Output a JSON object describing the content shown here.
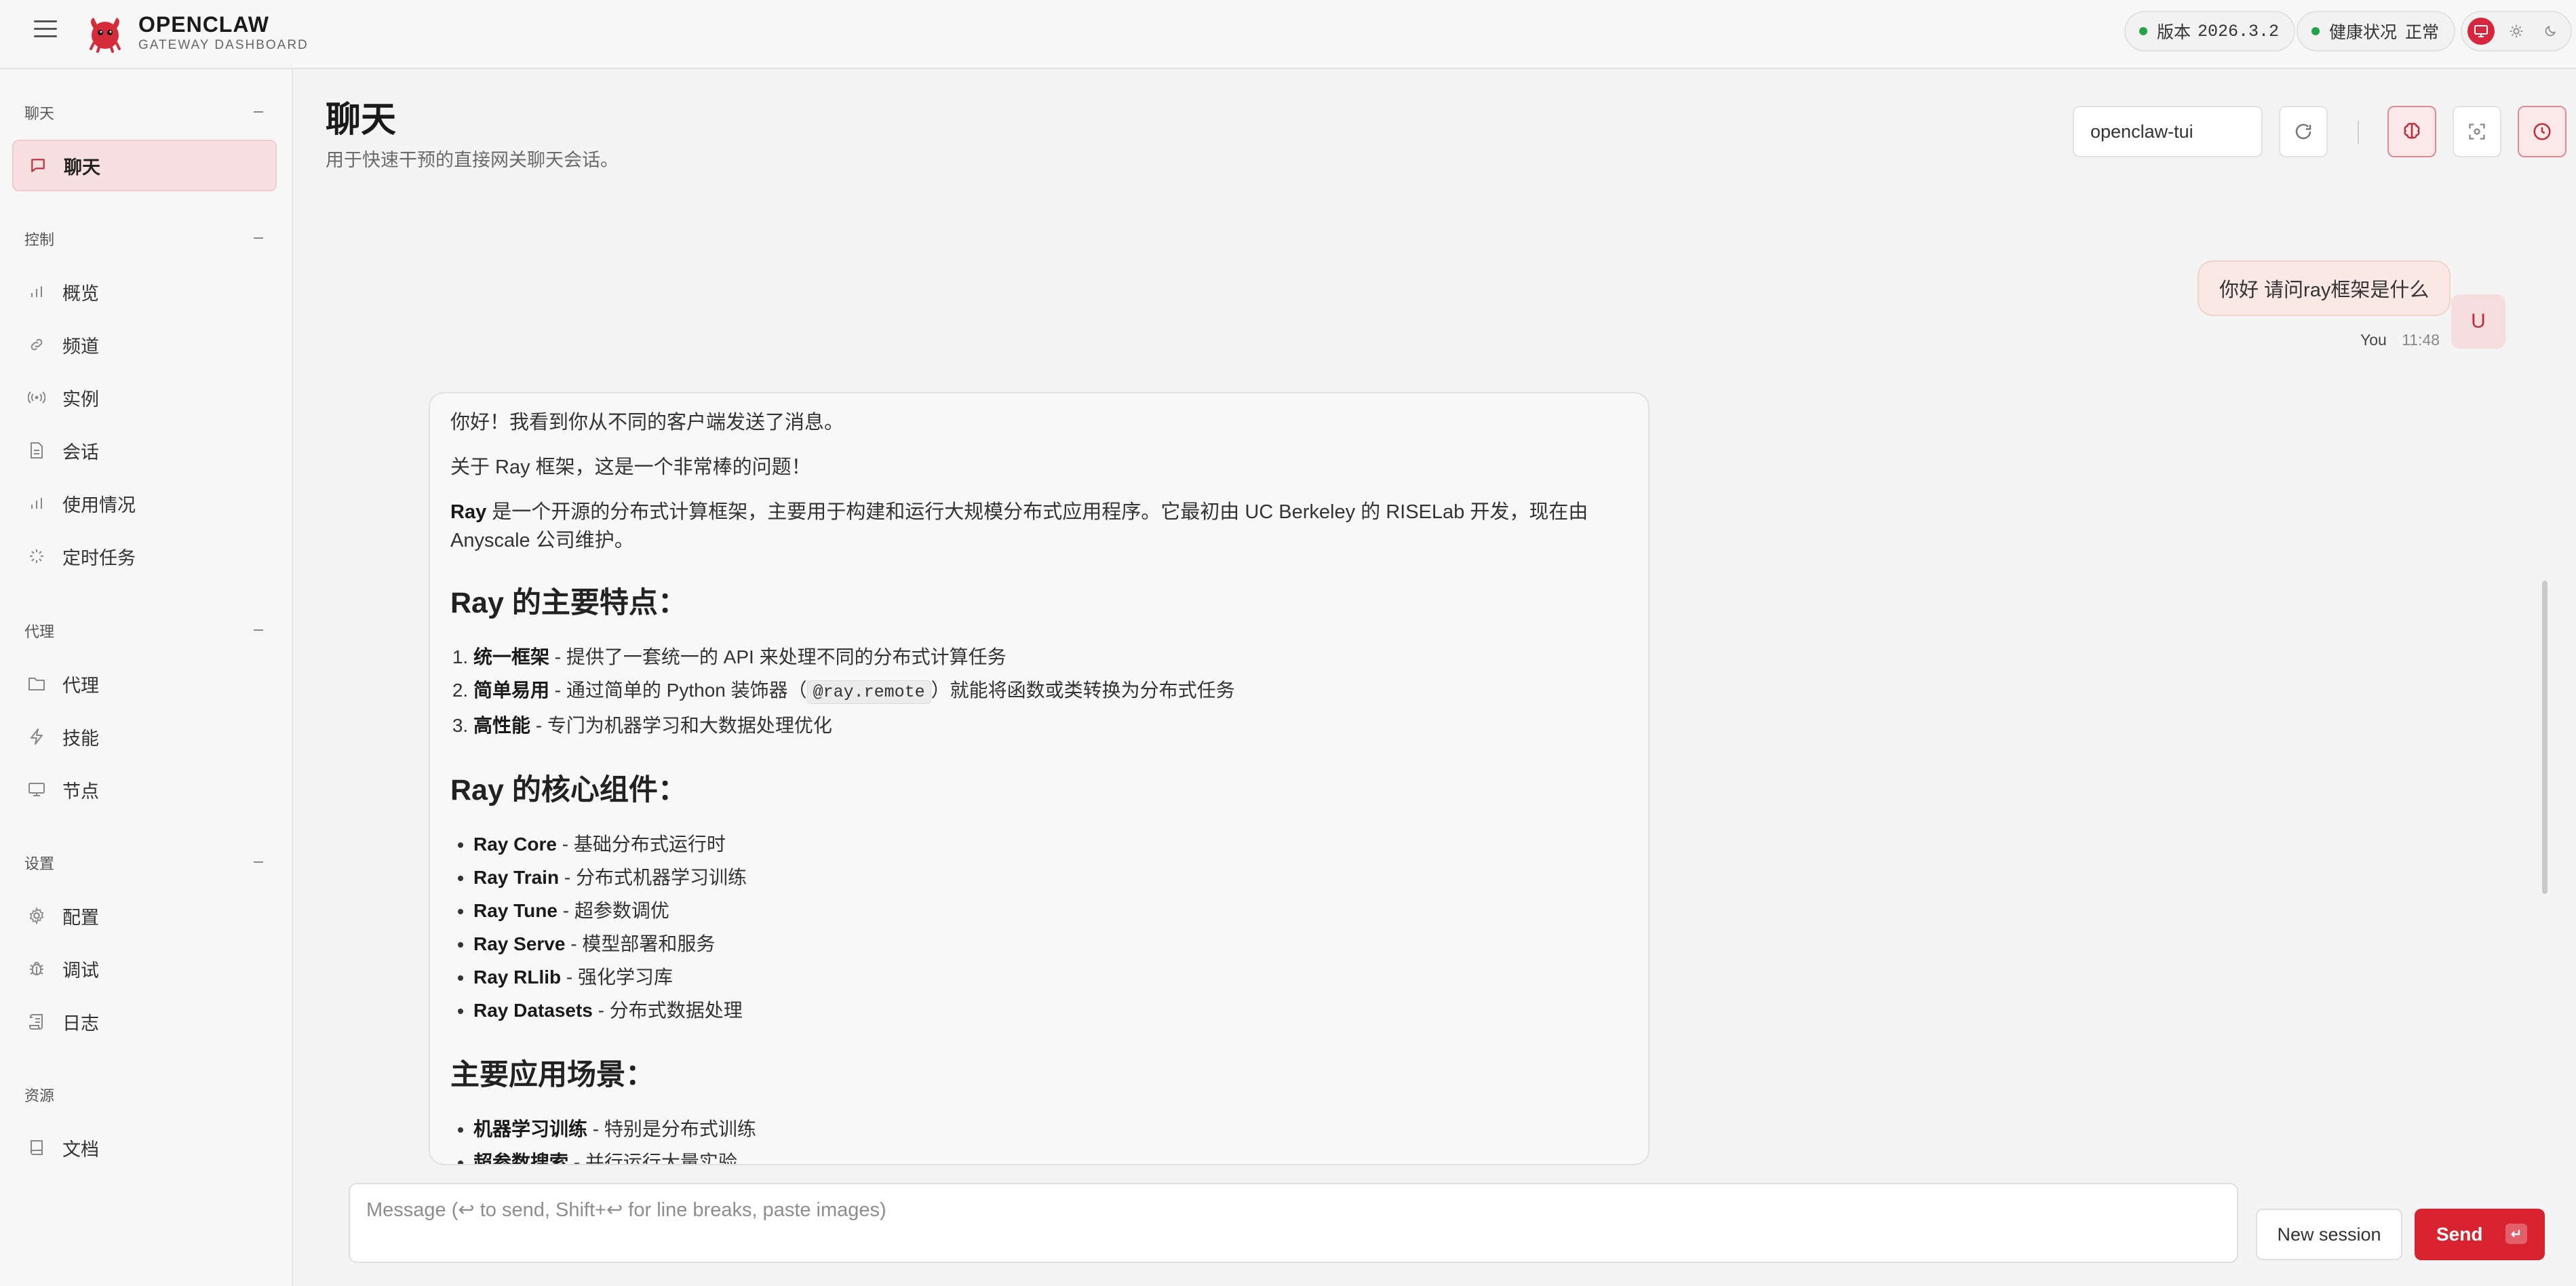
{
  "app": {
    "brand_name": "OPENCLAW",
    "brand_sub": "GATEWAY DASHBOARD",
    "accent": "#d92230"
  },
  "status": {
    "version_label": "版本",
    "version_value": "2026.3.2",
    "health_label": "健康状况",
    "health_value": "正常"
  },
  "sidebar": {
    "sections": [
      {
        "title": "聊天",
        "items": [
          {
            "label": "聊天",
            "icon": "chat-bubble-icon",
            "active": true
          }
        ]
      },
      {
        "title": "控制",
        "items": [
          {
            "label": "概览",
            "icon": "bar-chart-icon"
          },
          {
            "label": "频道",
            "icon": "link-icon"
          },
          {
            "label": "实例",
            "icon": "broadcast-icon"
          },
          {
            "label": "会话",
            "icon": "document-icon"
          },
          {
            "label": "使用情况",
            "icon": "bar-chart-icon"
          },
          {
            "label": "定时任务",
            "icon": "loader-icon"
          }
        ]
      },
      {
        "title": "代理",
        "items": [
          {
            "label": "代理",
            "icon": "folder-icon"
          },
          {
            "label": "技能",
            "icon": "lightning-icon"
          },
          {
            "label": "节点",
            "icon": "monitor-icon"
          }
        ]
      },
      {
        "title": "设置",
        "items": [
          {
            "label": "配置",
            "icon": "gear-icon"
          },
          {
            "label": "调试",
            "icon": "bug-icon"
          },
          {
            "label": "日志",
            "icon": "scroll-icon"
          }
        ]
      },
      {
        "title": "资源",
        "items": [
          {
            "label": "文档",
            "icon": "book-icon"
          }
        ]
      }
    ]
  },
  "header": {
    "title": "聊天",
    "subtitle": "用于快速干预的直接网关聊天会话。",
    "session_value": "openclaw-tui"
  },
  "messages": {
    "user": {
      "text": "你好 请问ray框架是什么",
      "avatar": "U",
      "author": "You",
      "time": "11:48"
    },
    "assistant": {
      "p1": "你好！我看到你从不同的客户端发送了消息。",
      "p2": "关于 Ray 框架，这是一个非常棒的问题！",
      "p3_bold": "Ray",
      "p3_rest": " 是一个开源的分布式计算框架，主要用于构建和运行大规模分布式应用程序。它最初由 UC Berkeley 的 RISELab 开发，现在由 Anyscale 公司维护。",
      "h1": "Ray 的主要特点：",
      "features": [
        {
          "bold": "统一框架",
          "rest": " - 提供了一套统一的 API 来处理不同的分布式计算任务"
        },
        {
          "bold": "简单易用",
          "pre": " - 通过简单的 Python 装饰器（",
          "code": "@ray.remote",
          "post": "）就能将函数或类转换为分布式任务"
        },
        {
          "bold": "高性能",
          "rest": " - 专门为机器学习和大数据处理优化"
        }
      ],
      "h2": "Ray 的核心组件：",
      "components": [
        {
          "bold": "Ray Core",
          "rest": " - 基础分布式运行时"
        },
        {
          "bold": "Ray Train",
          "rest": " - 分布式机器学习训练"
        },
        {
          "bold": "Ray Tune",
          "rest": " - 超参数调优"
        },
        {
          "bold": "Ray Serve",
          "rest": " - 模型部署和服务"
        },
        {
          "bold": "Ray RLlib",
          "rest": " - 强化学习库"
        },
        {
          "bold": "Ray Datasets",
          "rest": " - 分布式数据处理"
        }
      ],
      "h3": "主要应用场景：",
      "scenarios": [
        {
          "bold": "机器学习训练",
          "rest": " - 特别是分布式训练"
        },
        {
          "bold": "超参数搜索",
          "rest": " - 并行运行大量实验"
        }
      ]
    }
  },
  "composer": {
    "placeholder": "Message (↩ to send, Shift+↩ for line breaks, paste images)",
    "new_session_label": "New session",
    "send_label": "Send",
    "send_kbd": "↵"
  }
}
